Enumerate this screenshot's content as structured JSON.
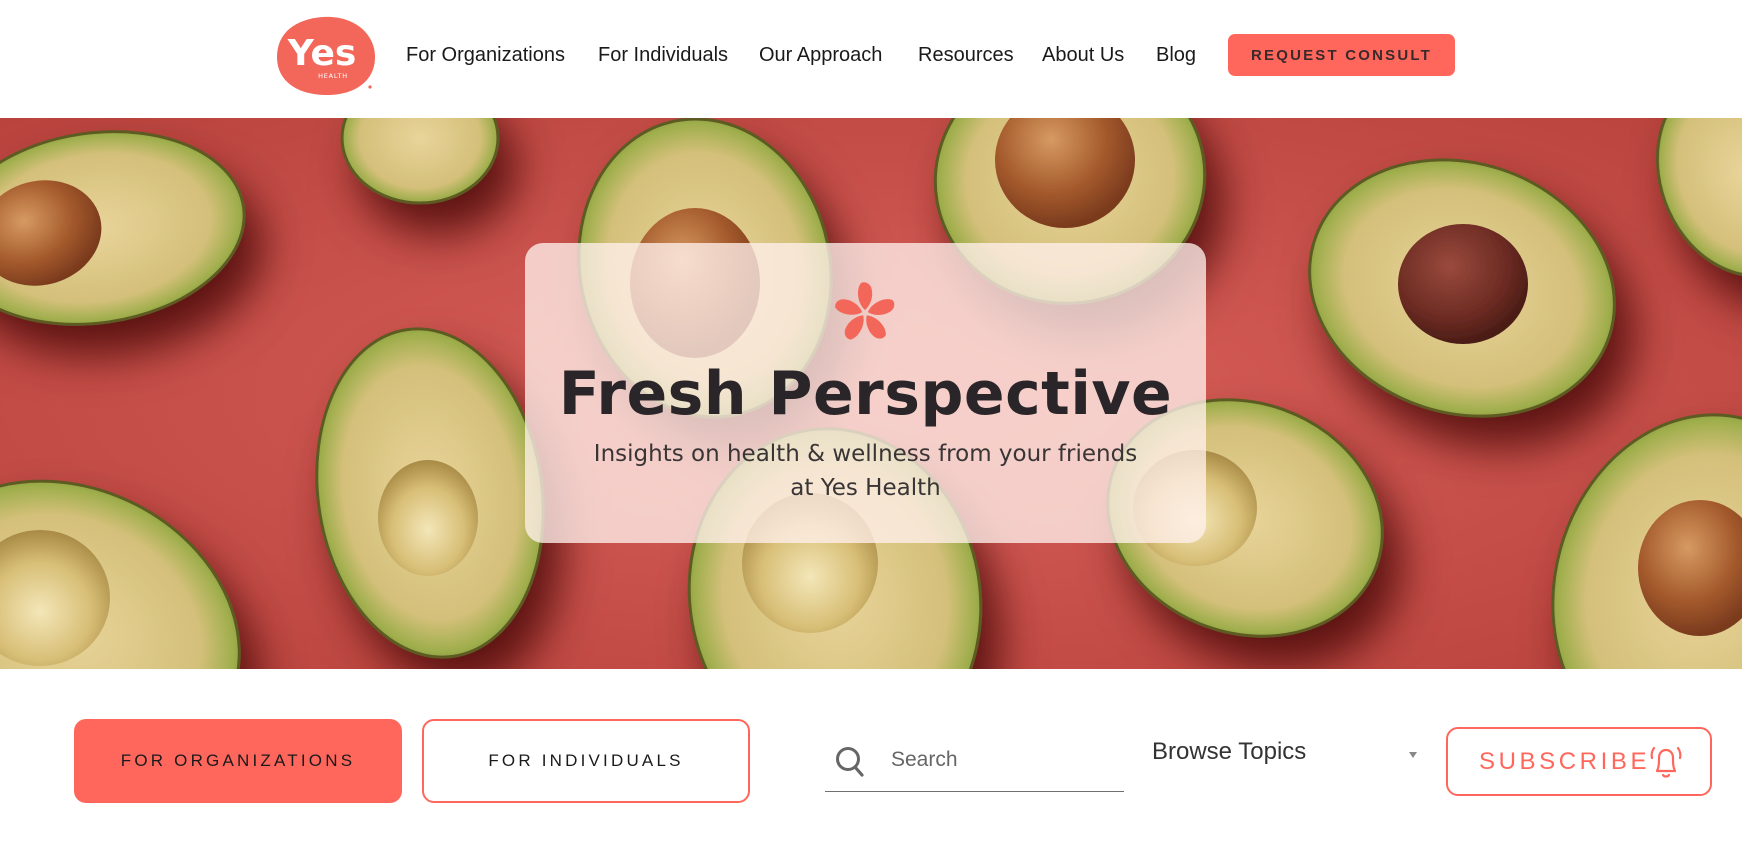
{
  "header": {
    "logo": {
      "text": "Yes",
      "subtext": "HEALTH",
      "icon": "yes-health-logo"
    },
    "nav": [
      {
        "label": "For Organizations"
      },
      {
        "label": "For Individuals"
      },
      {
        "label": "Our Approach"
      },
      {
        "label": "Resources"
      },
      {
        "label": "About Us"
      },
      {
        "label": "Blog"
      }
    ],
    "cta_label": "REQUEST CONSULT"
  },
  "hero": {
    "icon": "flower-icon",
    "title": "Fresh Perspective",
    "subtitle": "Insights on health & wellness from your friends at Yes Health",
    "background": "avocado-halves-on-red"
  },
  "filters": {
    "audience_buttons": [
      {
        "label": "FOR ORGANIZATIONS",
        "active": true
      },
      {
        "label": "FOR INDIVIDUALS",
        "active": false
      }
    ],
    "search": {
      "placeholder": "Search",
      "value": "",
      "icon": "search-icon"
    },
    "topics": {
      "selected": "Browse Topics",
      "icon": "caret-down-icon"
    },
    "subscribe": {
      "label": "SUBSCRIBE",
      "icon": "bell-icon"
    }
  },
  "colors": {
    "brand": "#ff675c",
    "text": "#1a1a1a",
    "hero_bg": "#c64a43"
  }
}
